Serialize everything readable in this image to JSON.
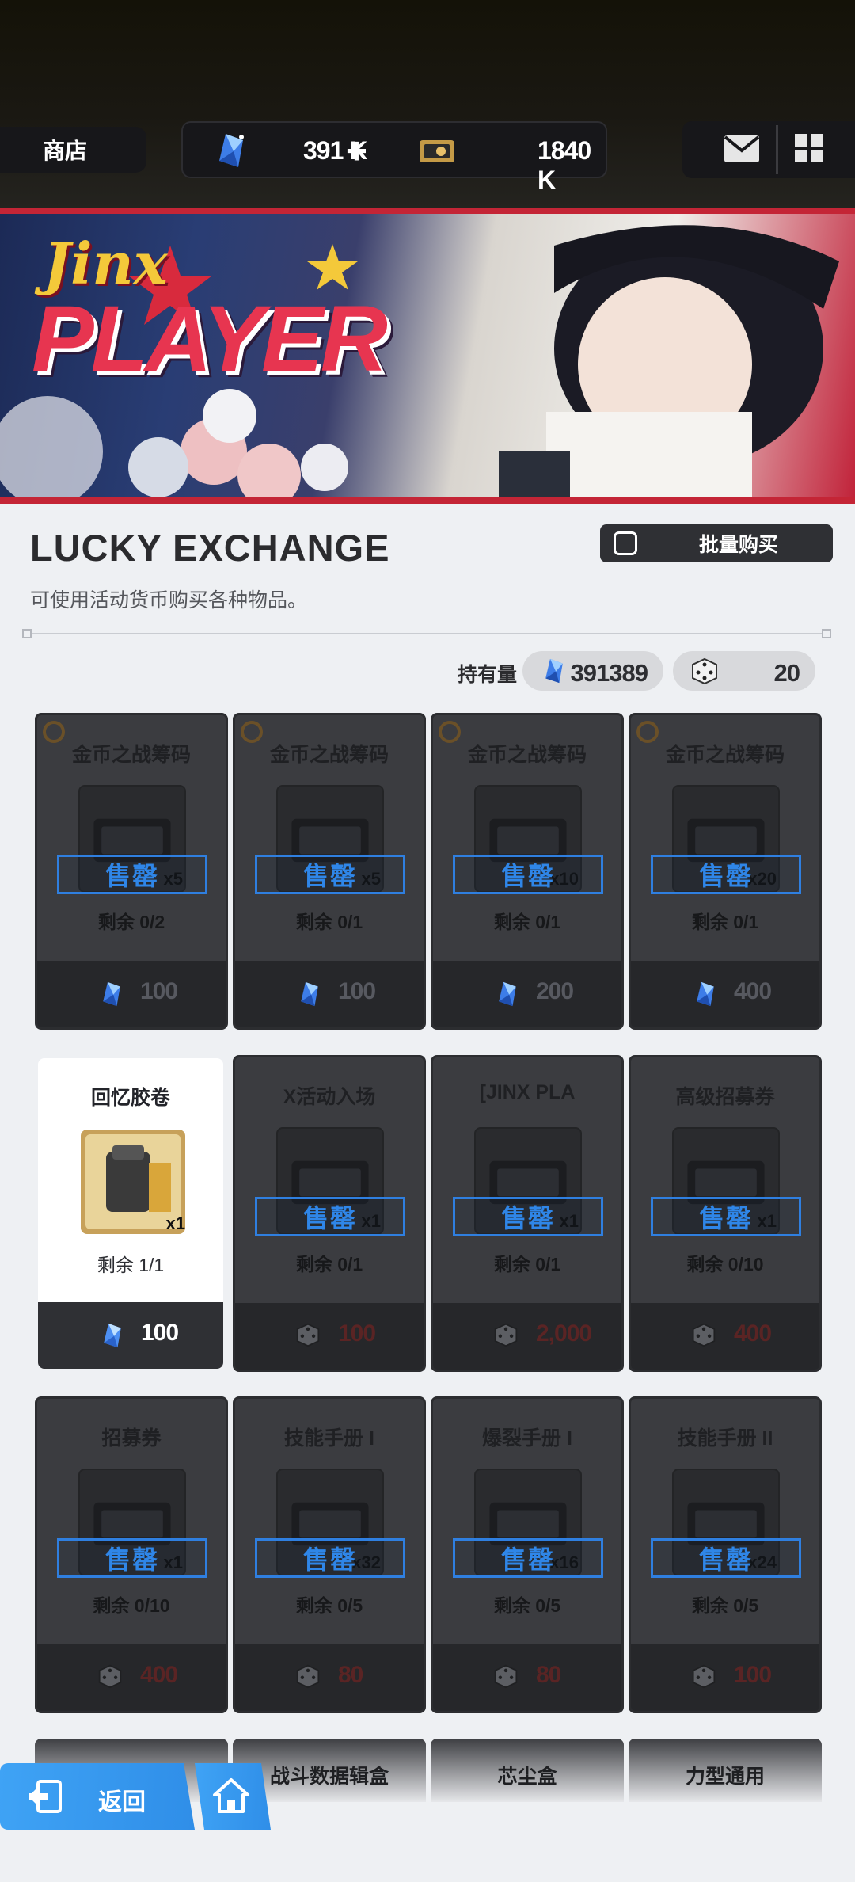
{
  "header": {
    "shop_tab": "商店",
    "currency1": "391 K",
    "currency1_plus": "+",
    "currency2": "1840 K",
    "mail_icon": "mail-icon",
    "menu_icon": "grid-icon"
  },
  "page": {
    "title": "LUCKY EXCHANGE",
    "subtitle": "可使用活动货币购买各种物品。",
    "bulk_button": "批量购买",
    "holdings_label": "持有量",
    "holding_gems": "391389",
    "holding_dice": "20"
  },
  "sold_label": "售罄",
  "cards": [
    {
      "name": "金币之战筹码",
      "qty": "x5",
      "remain": "剩余 0/2",
      "price": "100",
      "currency": "gem",
      "sold": true
    },
    {
      "name": "金币之战筹码",
      "qty": "x5",
      "remain": "剩余 0/1",
      "price": "100",
      "currency": "gem",
      "sold": true
    },
    {
      "name": "金币之战筹码",
      "qty": "x10",
      "remain": "剩余 0/1",
      "price": "200",
      "currency": "gem",
      "sold": true
    },
    {
      "name": "金币之战筹码",
      "qty": "x20",
      "remain": "剩余 0/1",
      "price": "400",
      "currency": "gem",
      "sold": true
    },
    {
      "name": "回忆胶卷",
      "qty": "x1",
      "remain": "剩余 1/1",
      "price": "100",
      "currency": "gem",
      "sold": false
    },
    {
      "name": "X活动入场",
      "qty": "x1",
      "remain": "剩余 0/1",
      "price": "100",
      "currency": "dice",
      "sold": true
    },
    {
      "name": "[JINX PLA",
      "qty": "x1",
      "remain": "剩余 0/1",
      "price": "2,000",
      "currency": "dice",
      "sold": true
    },
    {
      "name": "高级招募券",
      "qty": "x1",
      "remain": "剩余 0/10",
      "price": "400",
      "currency": "dice",
      "sold": true
    },
    {
      "name": "招募券",
      "qty": "x1",
      "remain": "剩余 0/10",
      "price": "400",
      "currency": "dice",
      "sold": true
    },
    {
      "name": "技能手册 I",
      "qty": "x32",
      "remain": "剩余 0/5",
      "price": "80",
      "currency": "dice",
      "sold": true
    },
    {
      "name": "爆裂手册 I",
      "qty": "x16",
      "remain": "剩余 0/5",
      "price": "80",
      "currency": "dice",
      "sold": true
    },
    {
      "name": "技能手册 II",
      "qty": "x24",
      "remain": "剩余 0/5",
      "price": "100",
      "currency": "dice",
      "sold": true
    }
  ],
  "partial_cards": [
    "",
    "战斗数据辑盒",
    "芯尘盒",
    "力型通用"
  ],
  "nav": {
    "back_label": "返回",
    "home_icon": "home-icon"
  }
}
